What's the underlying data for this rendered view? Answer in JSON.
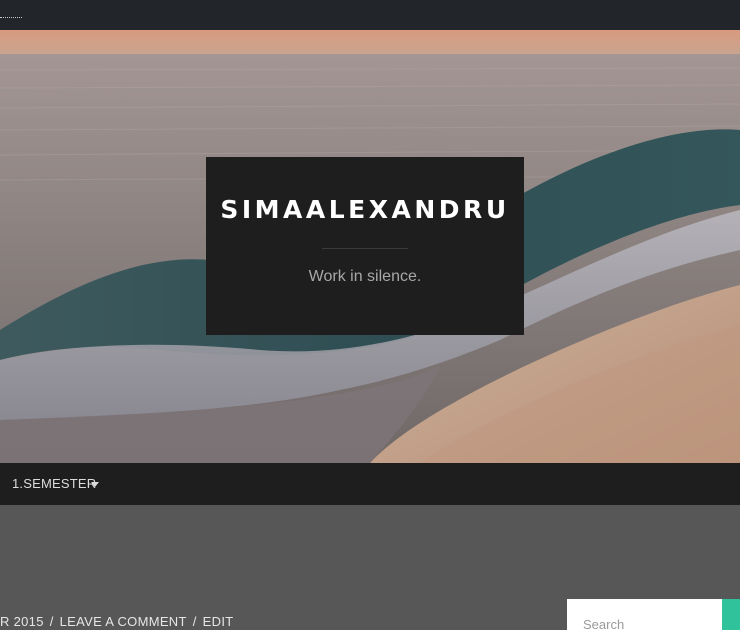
{
  "site": {
    "title": "SIMAALEXANDRU",
    "tagline": "Work in silence."
  },
  "nav": {
    "items": [
      {
        "label": "1.SEMESTER"
      }
    ]
  },
  "post_meta": {
    "date": "R 2015",
    "comment_link": "LEAVE A COMMENT",
    "edit_link": "EDIT",
    "separator": "/"
  },
  "search": {
    "placeholder": "Search",
    "value": ""
  },
  "colors": {
    "topbar": "#22262b",
    "dark_panel": "#1e1e1e",
    "content_bg": "#575757",
    "accent": "#2fc29b"
  },
  "icons": {
    "nav_dropdown": "caret-down-icon"
  }
}
